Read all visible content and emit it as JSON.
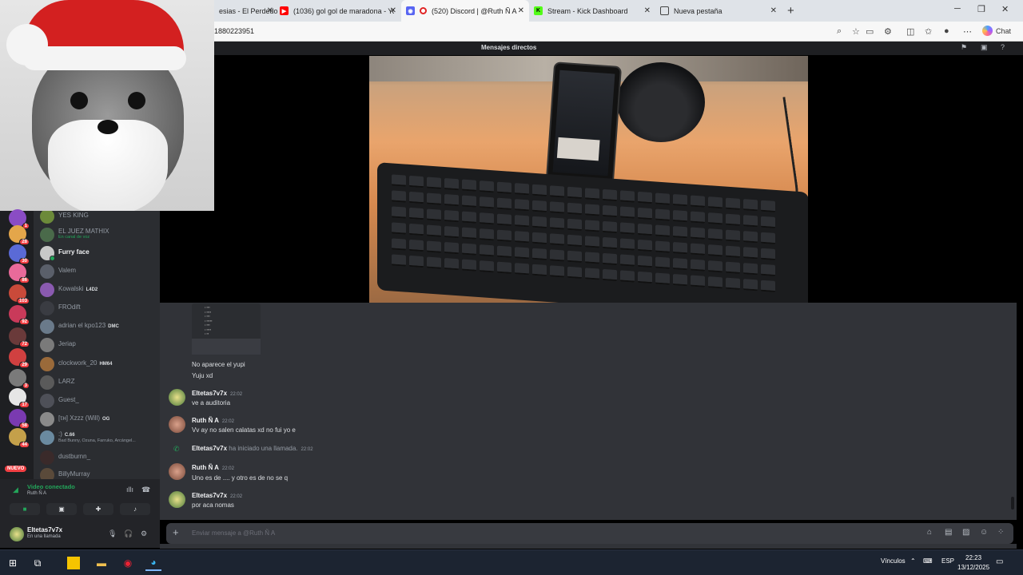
{
  "browser": {
    "tabs": [
      {
        "label": "esias - El Perdedor"
      },
      {
        "label": "(1036) gol gol de maradona - YouTube"
      },
      {
        "label": "(520) Discord | @Ruth Ñ A"
      },
      {
        "label": "Stream - Kick Dashboard"
      },
      {
        "label": "Nueva pestaña"
      }
    ],
    "url": "1880223951",
    "copilot_label": "Chat"
  },
  "discord": {
    "title": "Mensajes directos",
    "members": [
      {
        "name": "YES KING",
        "sub": "",
        "tag": ""
      },
      {
        "name": "EL JUEZ MATHIX",
        "sub": "En canal de voz",
        "tag": ""
      },
      {
        "name": "Furry face",
        "sub": "",
        "tag": ""
      },
      {
        "name": "Valem",
        "sub": "",
        "tag": ""
      },
      {
        "name": "Kowalski",
        "sub": "",
        "tag": "L4D2"
      },
      {
        "name": "FROdift",
        "sub": "",
        "tag": ""
      },
      {
        "name": "adrian el kpo123",
        "sub": "",
        "tag": "DMC"
      },
      {
        "name": "Jeriap",
        "sub": "",
        "tag": ""
      },
      {
        "name": "clockwork_20",
        "sub": "",
        "tag": "HM64"
      },
      {
        "name": "LARZ",
        "sub": "",
        "tag": ""
      },
      {
        "name": "Guest_",
        "sub": "",
        "tag": ""
      },
      {
        "name": "[τн] Xzzz (Will)",
        "sub": "",
        "tag": "OG"
      },
      {
        "name": ":)",
        "sub": "Bad Bunny, Ozuna, Farruko, Arcángel...",
        "tag": "C.66"
      },
      {
        "name": "dustburnn_",
        "sub": "",
        "tag": ""
      },
      {
        "name": "BillyMurray",
        "sub": "",
        "tag": ""
      }
    ],
    "server_badges": [
      "1",
      "28",
      "30",
      "86",
      "103",
      "92",
      "72",
      "29",
      "3",
      "17",
      "58",
      "44"
    ],
    "nuevo_label": "NUEVO",
    "voice": {
      "status": "Video conectado",
      "user": "Ruth Ñ A"
    },
    "user": {
      "name": "Eltetas7v7x",
      "status": "En una llamada"
    },
    "messages": [
      {
        "type": "cont",
        "text": "No aparece el yupi"
      },
      {
        "type": "cont",
        "text": "Yuju xd"
      },
      {
        "type": "msg",
        "author": "Eltetas7v7x",
        "time": "22:02",
        "text": "ve a auditoria"
      },
      {
        "type": "msg",
        "author": "Ruth Ñ A",
        "time": "22:02",
        "text": "Vv ay no salen calatas xd no fui yo e"
      },
      {
        "type": "call",
        "author": "Eltetas7v7x",
        "text": "ha iniciado una llamada.",
        "time": "22:02"
      },
      {
        "type": "msg",
        "author": "Ruth Ñ A",
        "time": "22:02",
        "text": "Uno es de .... y otro es de no se q"
      },
      {
        "type": "msg",
        "author": "Eltetas7v7x",
        "time": "22:02",
        "text": "por aca nomas"
      }
    ],
    "input_placeholder": "Enviar mensaje a @Ruth Ñ A"
  },
  "taskbar": {
    "vinculos": "Vínculos",
    "lang": "ESP",
    "time": "22:23",
    "date": "13/12/2025"
  },
  "colors": {
    "discord_bg": "#313338",
    "sidebar_bg": "#2b2d31",
    "online_green": "#23a55a",
    "badge_red": "#f23f43"
  }
}
